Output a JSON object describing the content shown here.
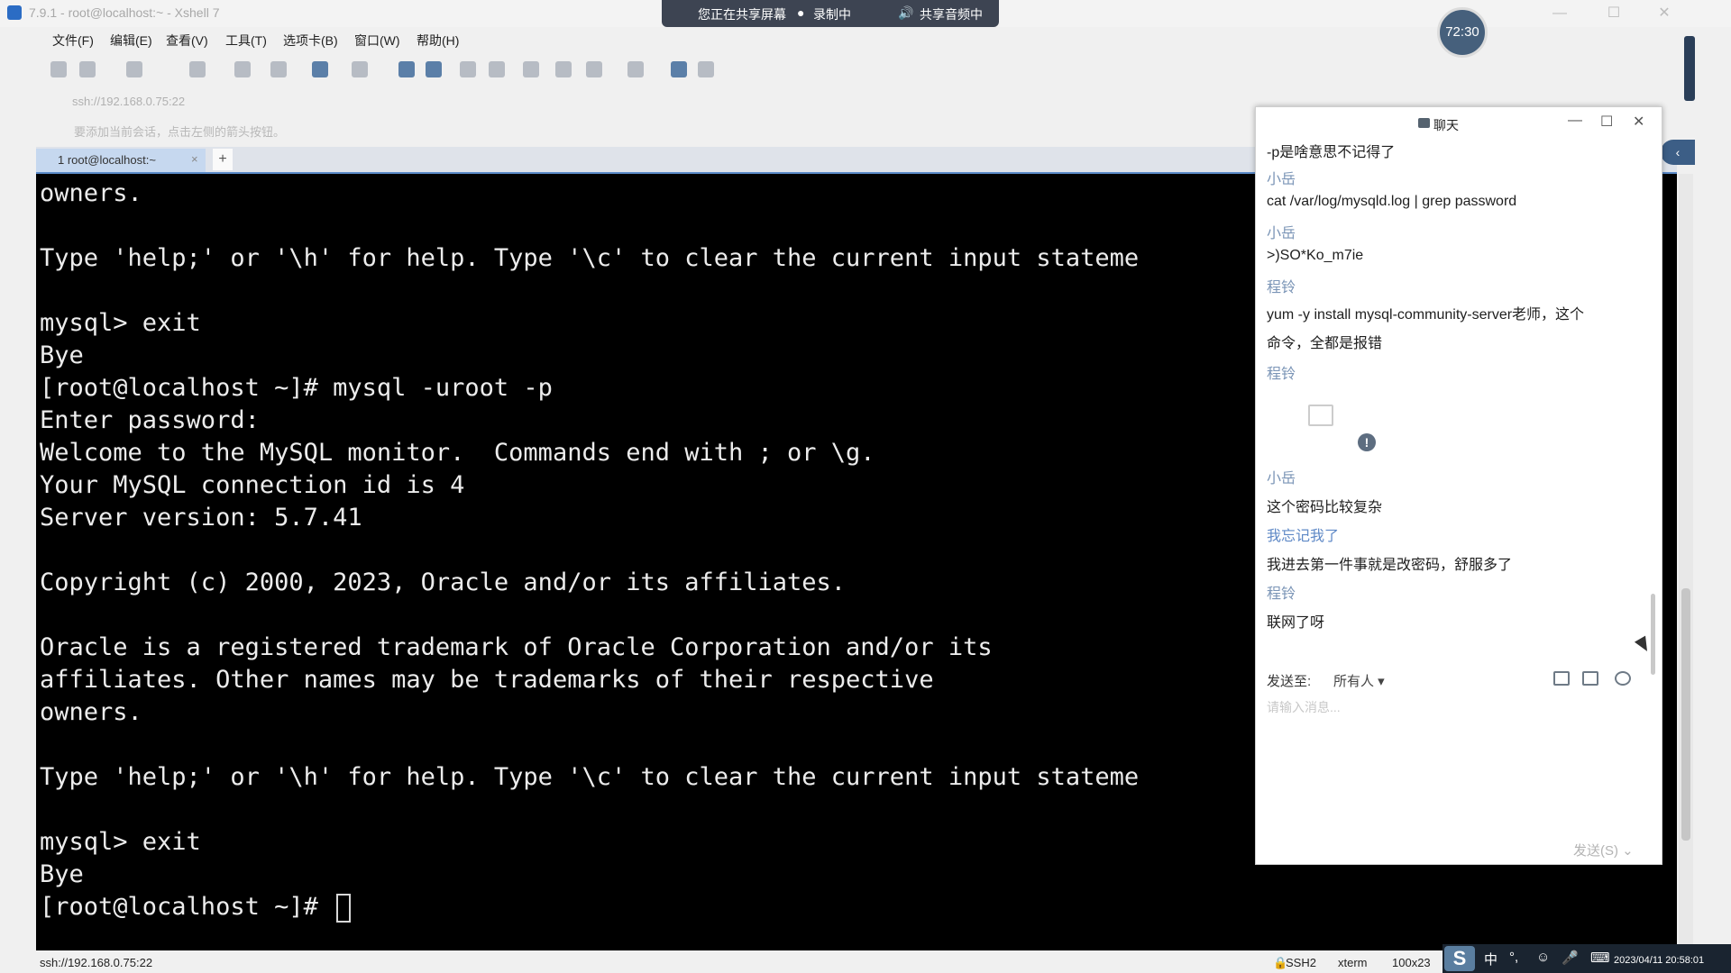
{
  "window": {
    "title": "7.9.1 - root@localhost:~ - Xshell 7",
    "controls": [
      "—",
      "☐",
      "✕"
    ]
  },
  "share_bar": {
    "sharing": "您正在共享屏幕",
    "recording": "录制中",
    "audio": "共享音频中"
  },
  "timer": "72:30",
  "menu": [
    "文件(F)",
    "编辑(E)",
    "查看(V)",
    "工具(T)",
    "选项卡(B)",
    "窗口(W)",
    "帮助(H)"
  ],
  "address": "ssh://192.168.0.75:22",
  "hint": "要添加当前会话，点击左侧的箭头按钮。",
  "tab": {
    "label": "1 root@localhost:~",
    "close": "×",
    "add": "+"
  },
  "terminal": {
    "lines": [
      "owners.",
      "",
      "Type 'help;' or '\\h' for help. Type '\\c' to clear the current input stateme",
      "",
      "mysql> exit",
      "Bye",
      "[root@localhost ~]# mysql -uroot -p",
      "Enter password:",
      "Welcome to the MySQL monitor.  Commands end with ; or \\g.",
      "Your MySQL connection id is 4",
      "Server version: 5.7.41",
      "",
      "Copyright (c) 2000, 2023, Oracle and/or its affiliates.",
      "",
      "Oracle is a registered trademark of Oracle Corporation and/or its",
      "affiliates. Other names may be trademarks of their respective",
      "owners.",
      "",
      "Type 'help;' or '\\h' for help. Type '\\c' to clear the current input stateme",
      "",
      "mysql> exit",
      "Bye",
      "[root@localhost ~]# "
    ]
  },
  "status": {
    "address": "ssh://192.168.0.75:22",
    "protocol": "SSH2",
    "term": "xterm",
    "size": "100x23",
    "date": "2023/04/11 20:58:01"
  },
  "tray": {
    "logo": "S",
    "ime": "中",
    "punct": "°,",
    "face": "☺",
    "mic": "🎤"
  },
  "chat": {
    "title": "聊天",
    "controls": [
      "—",
      "☐",
      "✕"
    ],
    "messages": [
      {
        "text": "-p是啥意思不记得了"
      },
      {
        "sender": "小岳"
      },
      {
        "text": "cat /var/log/mysqld.log | grep password"
      },
      {
        "sender": "小岳"
      },
      {
        "text": ">)SO*Ko_m7ie"
      },
      {
        "sender": "程铃"
      },
      {
        "text": "yum -y install mysql-community-server老师，这个"
      },
      {
        "text": "命令，全都是报错"
      },
      {
        "sender": "程铃"
      },
      {
        "sender": "小岳"
      },
      {
        "text": "这个密码比较复杂"
      },
      {
        "sender": "我忘记我了"
      },
      {
        "text": "我进去第一件事就是改密码，舒服多了"
      },
      {
        "sender": "程铃"
      },
      {
        "text": "联网了呀"
      }
    ],
    "error_mark": "!",
    "send_to_label": "发送至:",
    "recipient": "所有人 ▾",
    "input_placeholder": "请输入消息...",
    "send_button": "发送(S)  ⌄"
  }
}
